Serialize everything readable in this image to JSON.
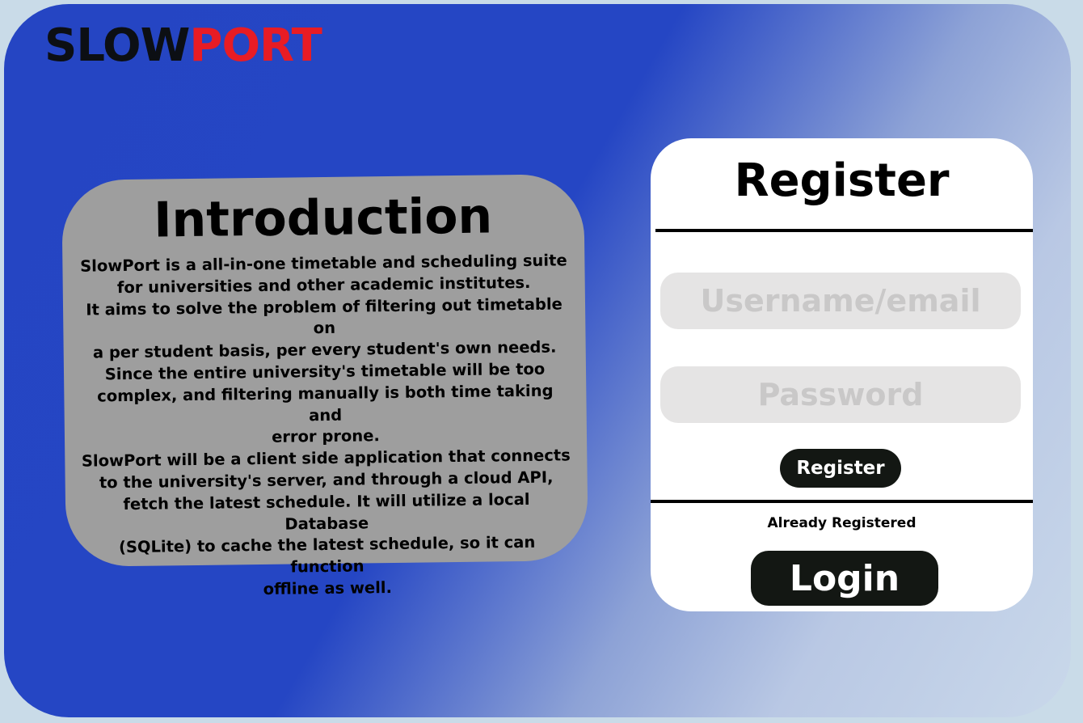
{
  "brand": {
    "part1": "SLOW",
    "part2": "PORT"
  },
  "intro": {
    "title": "Introduction",
    "body": "SlowPort is a all-in-one timetable and scheduling suite\nfor universities and other academic institutes.\nIt aims to solve the problem of filtering out timetable on\na per student basis, per every student's own needs.\nSince the entire university's timetable will be too\ncomplex, and filtering manually is both time taking and\nerror prone.\nSlowPort will be a client side application that connects\nto the university's server, and through a cloud API,\nfetch the latest schedule. It will utilize a local Database\n(SQLite) to cache the latest schedule, so it can function\noffline as well."
  },
  "register": {
    "title": "Register",
    "username_placeholder": "Username/email",
    "password_placeholder": "Password",
    "register_button": "Register",
    "already_text": "Already Registered",
    "login_button": "Login"
  },
  "colors": {
    "brand_dark": "#0c0f14",
    "brand_red": "#e81c24",
    "background_blue": "#2545c3",
    "button_dark": "#131713"
  }
}
